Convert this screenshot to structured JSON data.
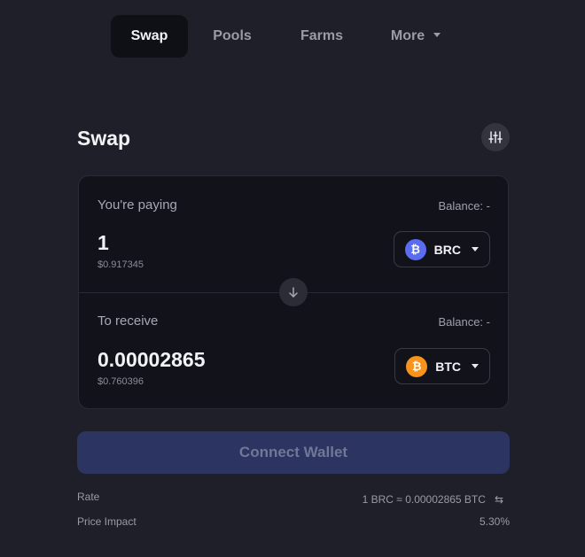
{
  "nav": {
    "items": [
      {
        "label": "Swap",
        "active": true
      },
      {
        "label": "Pools"
      },
      {
        "label": "Farms"
      },
      {
        "label": "More"
      }
    ]
  },
  "header": {
    "title": "Swap",
    "settings_icon": "sliders-icon"
  },
  "pay": {
    "label": "You're paying",
    "balance": "Balance: -",
    "amount": "1",
    "usd": "$0.917345",
    "token": {
      "symbol": "BRC",
      "icon": "bitcoin-icon",
      "color": "#5b6cf0"
    }
  },
  "receive": {
    "label": "To receive",
    "balance": "Balance: -",
    "amount": "0.00002865",
    "usd": "$0.760396",
    "token": {
      "symbol": "BTC",
      "icon": "bitcoin-icon",
      "color": "#f7931a"
    }
  },
  "connect_label": "Connect Wallet",
  "info": {
    "rate_label": "Rate",
    "rate_value": "1 BRC ≈ 0.00002865 BTC",
    "impact_label": "Price Impact",
    "impact_value": "5.30%"
  },
  "colors": {
    "background": "#1f1f29",
    "card": "#12121b",
    "button": "#2c3461"
  }
}
